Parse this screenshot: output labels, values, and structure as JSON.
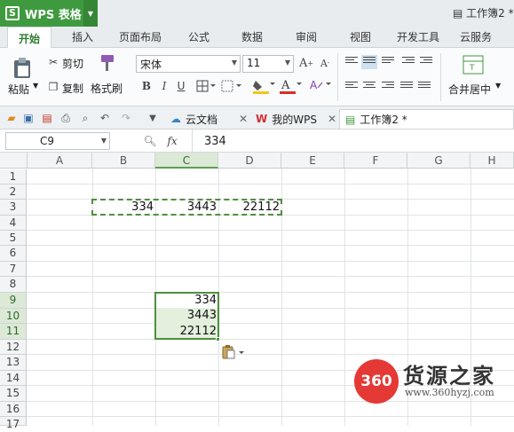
{
  "app": {
    "name": "WPS 表格",
    "logo_letter": "S",
    "doc_title": "工作簿2 *"
  },
  "menu_tabs": [
    "开始",
    "插入",
    "页面布局",
    "公式",
    "数据",
    "审阅",
    "视图",
    "开发工具",
    "云服务"
  ],
  "ribbon": {
    "paste": "粘贴",
    "cut": "剪切",
    "copy": "复制",
    "format_painter": "格式刷",
    "font_name": "宋体",
    "font_size": "11",
    "merge_center": "合并居中",
    "font_color": "#d32f2f",
    "fill_color": "#f5c518"
  },
  "doc_tabs": [
    {
      "label": "云文档",
      "icon": "cloud-icon"
    },
    {
      "label": "我的WPS",
      "icon": "wps-icon"
    },
    {
      "label": "工作簿2 *",
      "icon": "sheet-icon",
      "active": true
    }
  ],
  "formula_bar": {
    "cell_ref": "C9",
    "fx": "fx",
    "value": "334"
  },
  "columns": [
    "A",
    "B",
    "C",
    "D",
    "E",
    "F",
    "G",
    "H"
  ],
  "selected_column": "C",
  "rows": [
    "1",
    "2",
    "3",
    "4",
    "5",
    "6",
    "7",
    "8",
    "9",
    "10",
    "11",
    "12",
    "13",
    "14",
    "15",
    "16",
    "17"
  ],
  "selected_rows": [
    "9",
    "10",
    "11"
  ],
  "cells": {
    "B3": "334",
    "C3": "3443",
    "D3": "22112",
    "C9": "334",
    "C10": "3443",
    "C11": "22112"
  },
  "watermark": {
    "logo": "360",
    "name": "货源之家",
    "url": "www.360hyzj.com",
    "accent": "#e53935"
  },
  "accent_color": "#3f9a3f"
}
